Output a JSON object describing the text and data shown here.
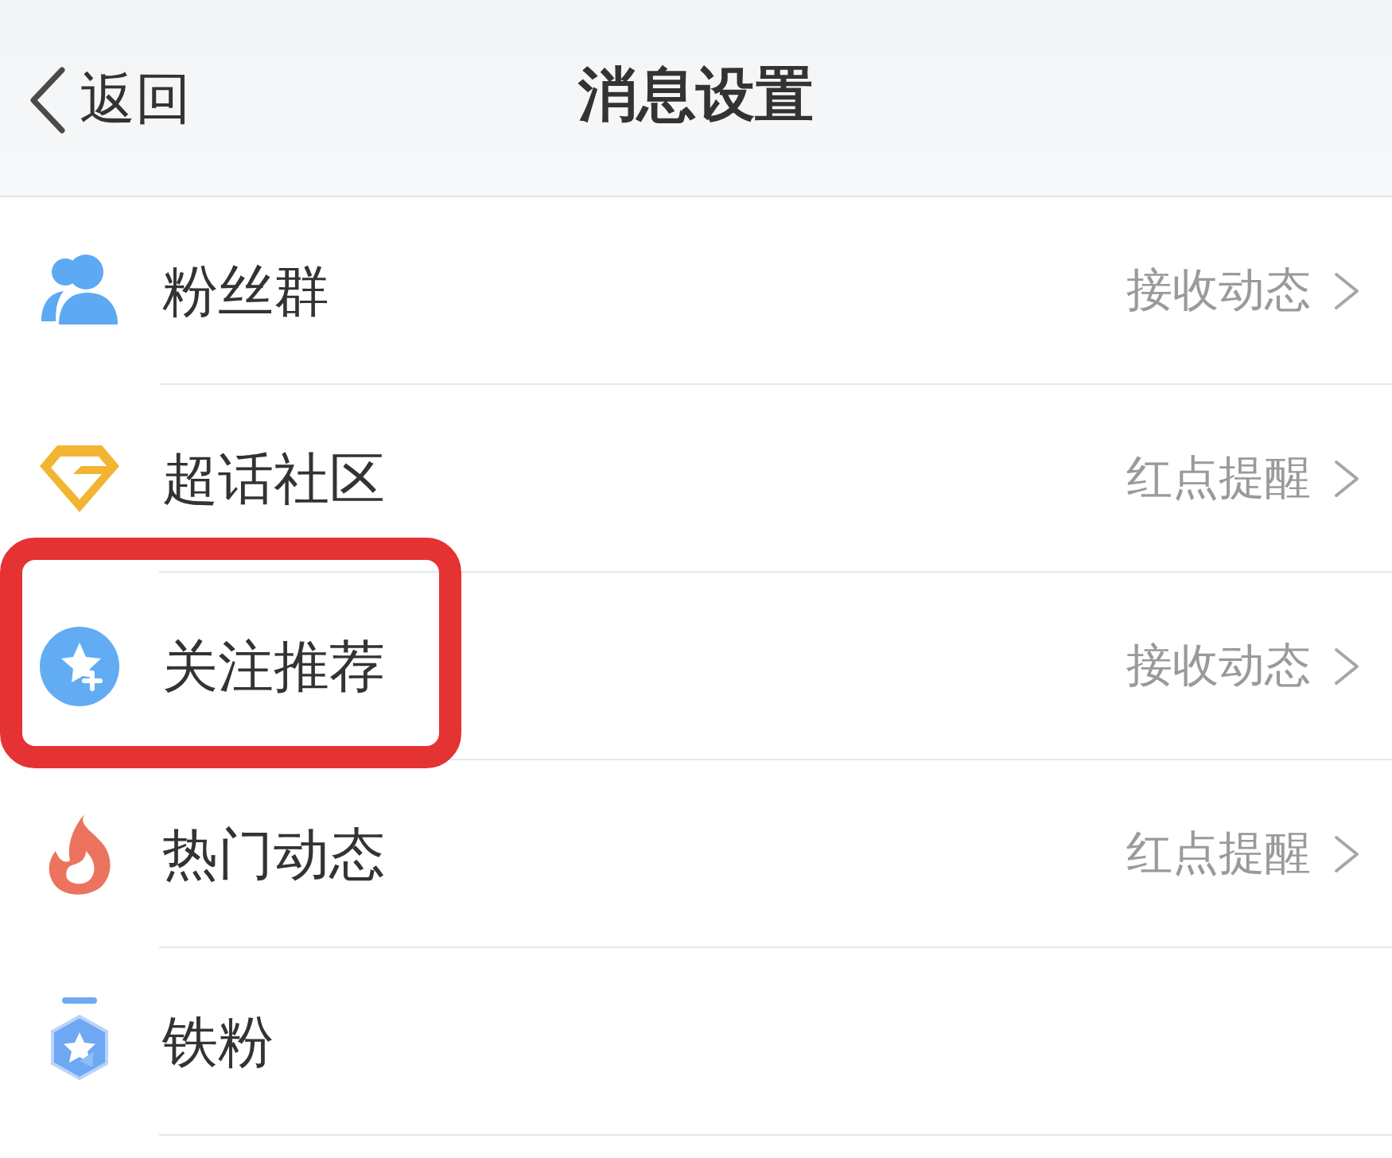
{
  "header": {
    "back_label": "返回",
    "title": "消息设置"
  },
  "rows": [
    {
      "label": "粉丝群",
      "value": "接收动态",
      "highlighted": false
    },
    {
      "label": "超话社区",
      "value": "红点提醒",
      "highlighted": false
    },
    {
      "label": "关注推荐",
      "value": "接收动态",
      "highlighted": true
    },
    {
      "label": "热门动态",
      "value": "红点提醒",
      "highlighted": false
    },
    {
      "label": "铁粉",
      "highlighted": false
    }
  ]
}
